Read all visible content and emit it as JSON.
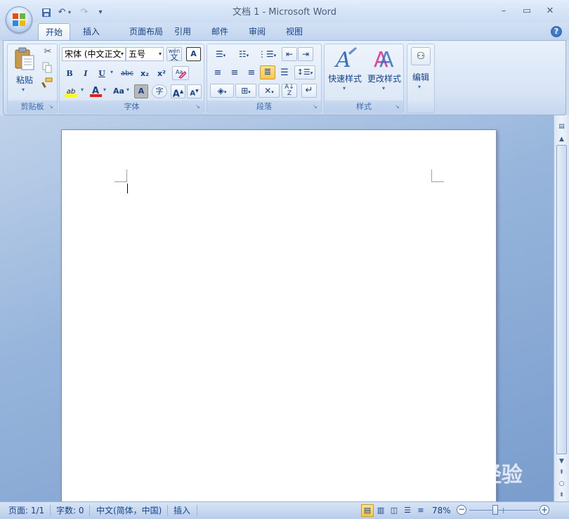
{
  "window": {
    "title": "文档 1 - Microsoft Word",
    "controls": {
      "minimize": "–",
      "restore": "▭",
      "close": "✕"
    }
  },
  "qat": {
    "save_icon": "save-icon",
    "undo_icon": "undo-icon",
    "redo_icon": "redo-icon",
    "customize": "▾"
  },
  "tabs": [
    {
      "label": "开始",
      "active": true
    },
    {
      "label": "插入"
    },
    {
      "label": "页面布局"
    },
    {
      "label": "引用"
    },
    {
      "label": "邮件"
    },
    {
      "label": "审阅"
    },
    {
      "label": "视图"
    }
  ],
  "help": "?",
  "ribbon": {
    "clipboard": {
      "label": "剪贴板",
      "paste_label": "粘贴"
    },
    "font": {
      "label": "字体",
      "font_name": "宋体 (中文正文",
      "font_size": "五号",
      "phonetic": "wén",
      "phonetic_char": "文",
      "border_char": "A",
      "bold": "B",
      "italic": "I",
      "underline": "U",
      "strike": "abc",
      "subscript": "x₂",
      "superscript": "x²",
      "highlight": "ab",
      "font_color": "A",
      "change_case": "Aa",
      "char_shading": "A",
      "enclose": "字",
      "grow": "A",
      "shrink": "A"
    },
    "paragraph": {
      "label": "段落"
    },
    "styles": {
      "label": "样式",
      "quick_styles": "快速样式",
      "change_styles": "更改样式"
    },
    "editing": {
      "label": "编辑"
    }
  },
  "status": {
    "page": "页面: 1/1",
    "words": "字数: 0",
    "language": "中文(简体，中国)",
    "mode": "插入",
    "zoom": "78%"
  },
  "watermark": "Bai 经验",
  "colors": {
    "accent": "#15428b",
    "highlight_yellow": "#ffff00",
    "font_red": "#e0201b",
    "ribbon_bg": "#dde8f6"
  }
}
